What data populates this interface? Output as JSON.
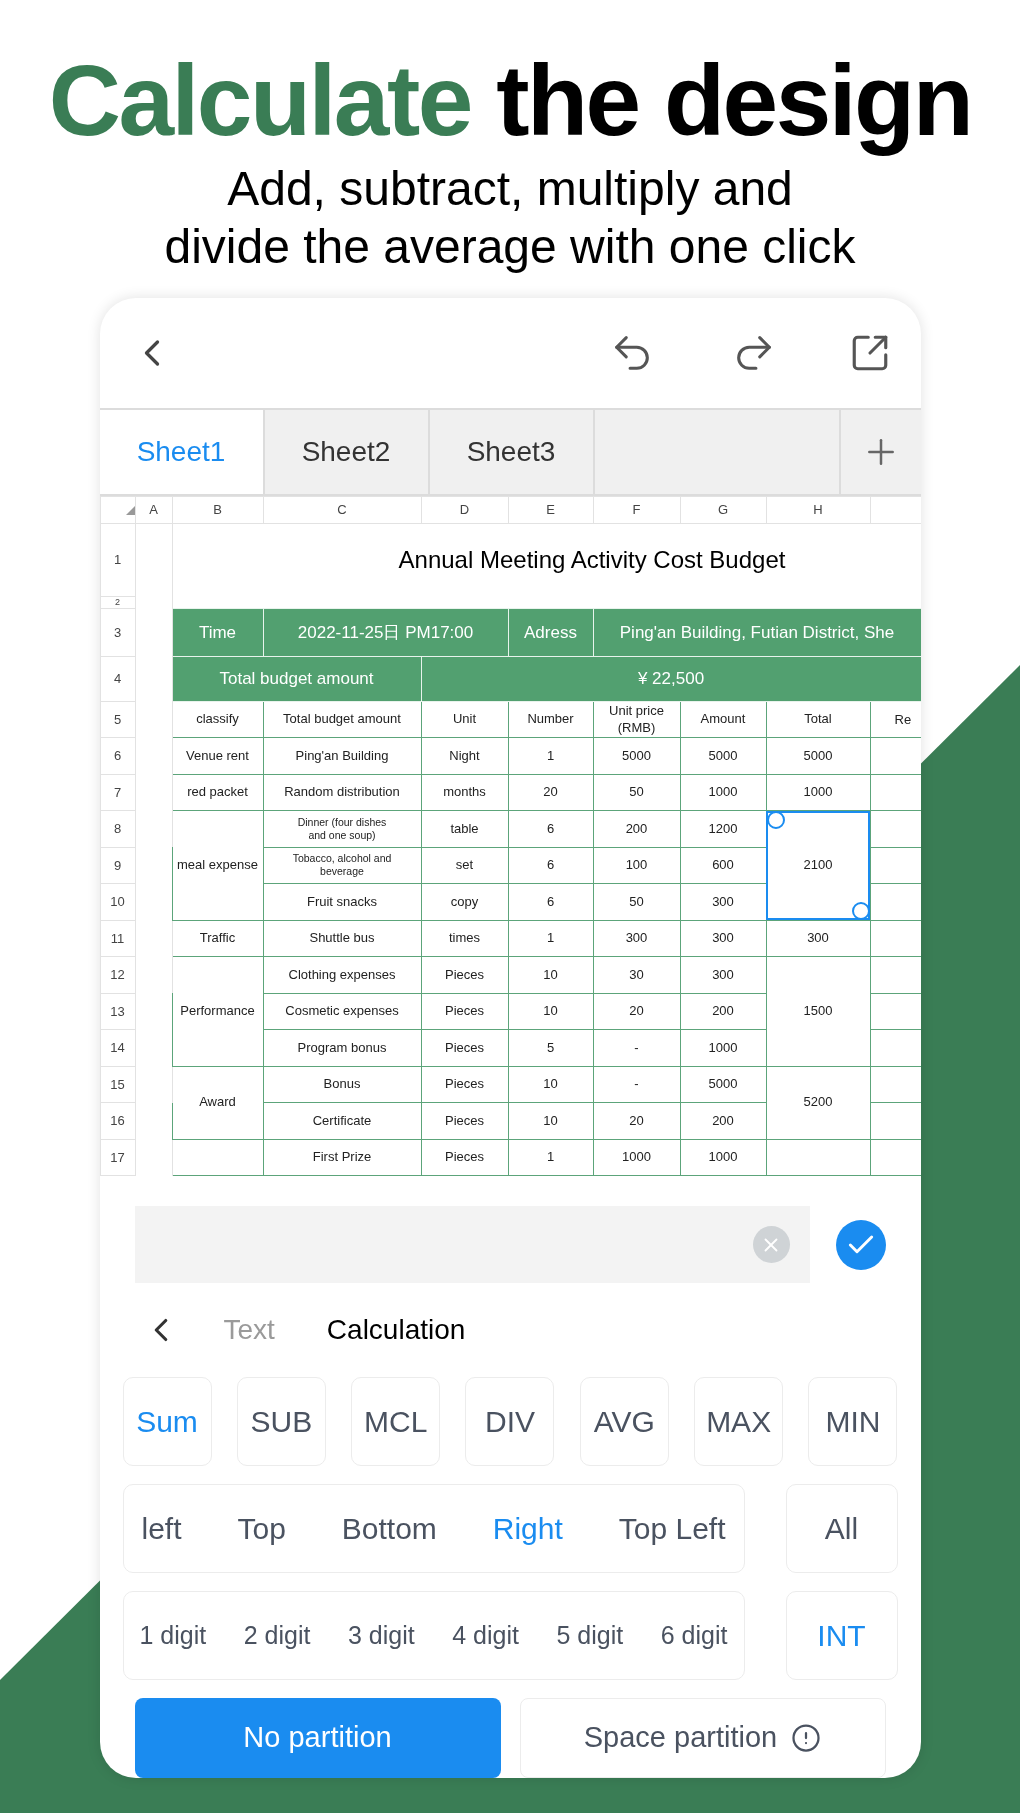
{
  "headline": {
    "parts": [
      {
        "text": "Calculate",
        "kind": "accent"
      },
      {
        "text": "the design",
        "kind": "plain"
      }
    ]
  },
  "subtitle": [
    "Add, subtract, multiply and",
    "divide the average with one click"
  ],
  "tabs": [
    {
      "label": "Sheet1",
      "selected": true
    },
    {
      "label": "Sheet2",
      "selected": false
    },
    {
      "label": "Sheet3",
      "selected": false
    }
  ],
  "sheet": {
    "columns": [
      "A",
      "B",
      "C",
      "D",
      "E",
      "F",
      "G",
      "H"
    ],
    "rows": [
      {
        "number": "1",
        "cells": [
          {
            "kind": "blank",
            "selected": false
          },
          {
            "kind": "title",
            "text": "Annual Meeting Activity Cost Budget",
            "colspan": 7,
            "selected": false
          }
        ]
      },
      {
        "number": "2"
      },
      {
        "number": "3",
        "cells": [
          {
            "kind": "band",
            "text": "Time",
            "selected": false
          },
          {
            "kind": "band",
            "text": "2022-11-25日 PM17:00",
            "colspan": 2,
            "selected": false
          },
          {
            "kind": "band",
            "text": "Adress",
            "selected": false
          },
          {
            "kind": "band",
            "text": "Ping'an Building, Futian District, She",
            "colspan": 4,
            "selected": false
          }
        ]
      },
      {
        "number": "4",
        "cells": [
          {
            "kind": "band",
            "text": "Total budget amount",
            "colspan": 2,
            "selected": false
          },
          {
            "kind": "band",
            "text": "¥ 22,500",
            "colspan": 6,
            "selected": false
          }
        ]
      },
      {
        "number": "5",
        "cells": [
          {
            "kind": "head",
            "text": "classify",
            "selected": false
          },
          {
            "kind": "head",
            "text": "Total budget amount",
            "selected": false
          },
          {
            "kind": "head",
            "text": "Unit",
            "selected": false
          },
          {
            "kind": "head",
            "text": "Number",
            "selected": false
          },
          {
            "kind": "head",
            "text": "Unit price (RMB)",
            "selected": false
          },
          {
            "kind": "head",
            "text": "Amount",
            "selected": false
          },
          {
            "kind": "head",
            "text": "Total",
            "selected": false
          },
          {
            "kind": "edge",
            "text": "Re",
            "selected": false
          }
        ]
      },
      {
        "number": "6",
        "cells": [
          {
            "kind": "data",
            "text": "Venue rent",
            "selected": false
          },
          {
            "kind": "data",
            "text": "Ping'an Building",
            "selected": false
          },
          {
            "kind": "data",
            "text": "Night",
            "selected": false
          },
          {
            "kind": "data",
            "text": "1",
            "selected": false
          },
          {
            "kind": "data",
            "text": "5000",
            "selected": false
          },
          {
            "kind": "data",
            "text": "5000",
            "selected": false
          },
          {
            "kind": "data",
            "text": "5000",
            "selected": false
          },
          {
            "kind": "empty",
            "selected": false
          }
        ]
      },
      {
        "number": "7",
        "cells": [
          {
            "kind": "data",
            "text": "red packet",
            "selected": false
          },
          {
            "kind": "data",
            "text": "Random distribution",
            "selected": false
          },
          {
            "kind": "data",
            "text": "months",
            "selected": false
          },
          {
            "kind": "data",
            "text": "20",
            "selected": false
          },
          {
            "kind": "data",
            "text": "50",
            "selected": false
          },
          {
            "kind": "data",
            "text": "1000",
            "selected": false
          },
          {
            "kind": "data",
            "text": "1000",
            "selected": false
          },
          {
            "kind": "empty",
            "selected": false
          }
        ]
      },
      {
        "number": "8",
        "cells": [
          {
            "kind": "data",
            "text": "meal expense",
            "rowspan": 3,
            "selected": false
          },
          {
            "kind": "small",
            "text": "Dinner (four dishes and one soup)",
            "selected": false
          },
          {
            "kind": "data",
            "text": "table",
            "selected": false
          },
          {
            "kind": "data",
            "text": "6",
            "selected": false
          },
          {
            "kind": "data",
            "text": "200",
            "selected": false
          },
          {
            "kind": "data",
            "text": "1200",
            "selected": false
          },
          {
            "kind": "data",
            "text": "2100",
            "rowspan": 3,
            "selected": true
          },
          {
            "kind": "empty",
            "selected": false
          }
        ]
      },
      {
        "number": "9",
        "cells": [
          {
            "kind": "small",
            "text": "Tobacco, alcohol and beverage",
            "selected": false
          },
          {
            "kind": "data",
            "text": "set",
            "selected": false
          },
          {
            "kind": "data",
            "text": "6",
            "selected": false
          },
          {
            "kind": "data",
            "text": "100",
            "selected": false
          },
          {
            "kind": "data",
            "text": "600",
            "selected": false
          },
          {
            "kind": "empty",
            "selected": false
          }
        ]
      },
      {
        "number": "10",
        "cells": [
          {
            "kind": "data",
            "text": "Fruit snacks",
            "selected": false
          },
          {
            "kind": "data",
            "text": "copy",
            "selected": false
          },
          {
            "kind": "data",
            "text": "6",
            "selected": false
          },
          {
            "kind": "data",
            "text": "50",
            "selected": false
          },
          {
            "kind": "data",
            "text": "300",
            "selected": false
          },
          {
            "kind": "empty",
            "selected": false
          }
        ]
      },
      {
        "number": "11",
        "cells": [
          {
            "kind": "data",
            "text": "Traffic",
            "selected": false
          },
          {
            "kind": "data",
            "text": "Shuttle bus",
            "selected": false
          },
          {
            "kind": "data",
            "text": "times",
            "selected": false
          },
          {
            "kind": "data",
            "text": "1",
            "selected": false
          },
          {
            "kind": "data",
            "text": "300",
            "selected": false
          },
          {
            "kind": "data",
            "text": "300",
            "selected": false
          },
          {
            "kind": "data",
            "text": "300",
            "selected": false
          },
          {
            "kind": "empty",
            "selected": false
          }
        ]
      },
      {
        "number": "12",
        "cells": [
          {
            "kind": "data",
            "text": "Performance",
            "rowspan": 3,
            "selected": false
          },
          {
            "kind": "data",
            "text": "Clothing expenses",
            "selected": false
          },
          {
            "kind": "data",
            "text": "Pieces",
            "selected": false
          },
          {
            "kind": "data",
            "text": "10",
            "selected": false
          },
          {
            "kind": "data",
            "text": "30",
            "selected": false
          },
          {
            "kind": "data",
            "text": "300",
            "selected": false
          },
          {
            "kind": "data",
            "text": "1500",
            "rowspan": 3,
            "selected": false
          },
          {
            "kind": "empty",
            "selected": false
          }
        ]
      },
      {
        "number": "13",
        "cells": [
          {
            "kind": "data",
            "text": "Cosmetic expenses",
            "selected": false
          },
          {
            "kind": "data",
            "text": "Pieces",
            "selected": false
          },
          {
            "kind": "data",
            "text": "10",
            "selected": false
          },
          {
            "kind": "data",
            "text": "20",
            "selected": false
          },
          {
            "kind": "data",
            "text": "200",
            "selected": false
          },
          {
            "kind": "empty",
            "selected": false
          }
        ]
      },
      {
        "number": "14",
        "cells": [
          {
            "kind": "data",
            "text": "Program bonus",
            "selected": false
          },
          {
            "kind": "data",
            "text": "Pieces",
            "selected": false
          },
          {
            "kind": "data",
            "text": "5",
            "selected": false
          },
          {
            "kind": "data",
            "text": "-",
            "selected": false
          },
          {
            "kind": "data",
            "text": "1000",
            "selected": false
          },
          {
            "kind": "empty",
            "selected": false
          }
        ]
      },
      {
        "number": "15",
        "cells": [
          {
            "kind": "data",
            "text": "Award",
            "rowspan": 2,
            "selected": false
          },
          {
            "kind": "data",
            "text": "Bonus",
            "selected": false
          },
          {
            "kind": "data",
            "text": "Pieces",
            "selected": false
          },
          {
            "kind": "data",
            "text": "10",
            "selected": false
          },
          {
            "kind": "data",
            "text": "-",
            "selected": false
          },
          {
            "kind": "data",
            "text": "5000",
            "selected": false
          },
          {
            "kind": "data",
            "text": "5200",
            "rowspan": 2,
            "selected": false
          },
          {
            "kind": "empty",
            "selected": false
          }
        ]
      },
      {
        "number": "16",
        "cells": [
          {
            "kind": "data",
            "text": "Certificate",
            "selected": false
          },
          {
            "kind": "data",
            "text": "Pieces",
            "selected": false
          },
          {
            "kind": "data",
            "text": "10",
            "selected": false
          },
          {
            "kind": "data",
            "text": "20",
            "selected": false
          },
          {
            "kind": "data",
            "text": "200",
            "selected": false
          },
          {
            "kind": "empty",
            "selected": false
          }
        ]
      },
      {
        "number": "17",
        "cells": [
          {
            "kind": "empty",
            "selected": false
          },
          {
            "kind": "data",
            "text": "First Prize",
            "selected": false
          },
          {
            "kind": "data",
            "text": "Pieces",
            "selected": false
          },
          {
            "kind": "data",
            "text": "1",
            "selected": false
          },
          {
            "kind": "data",
            "text": "1000",
            "selected": false
          },
          {
            "kind": "data",
            "text": "1000",
            "selected": false
          },
          {
            "kind": "empty",
            "selected": false
          },
          {
            "kind": "empty",
            "selected": false
          }
        ]
      }
    ]
  },
  "mode_tabs": [
    {
      "label": "Text",
      "selected": false
    },
    {
      "label": "Calculation",
      "selected": true
    }
  ],
  "functions": [
    {
      "label": "Sum",
      "selected": true
    },
    {
      "label": "SUB",
      "selected": false
    },
    {
      "label": "MCL",
      "selected": false
    },
    {
      "label": "DIV",
      "selected": false
    },
    {
      "label": "AVG",
      "selected": false
    },
    {
      "label": "MAX",
      "selected": false
    },
    {
      "label": "MIN",
      "selected": false
    }
  ],
  "directions": [
    {
      "label": "left",
      "selected": false
    },
    {
      "label": "Top",
      "selected": false
    },
    {
      "label": "Bottom",
      "selected": false
    },
    {
      "label": "Right",
      "selected": true
    },
    {
      "label": "Top Left",
      "selected": false
    }
  ],
  "all_button": {
    "label": "All",
    "selected": false
  },
  "digits": [
    {
      "label": "1 digit",
      "selected": false
    },
    {
      "label": "2 digit",
      "selected": false
    },
    {
      "label": "3 digit",
      "selected": false
    },
    {
      "label": "4 digit",
      "selected": false
    },
    {
      "label": "5 digit",
      "selected": false
    },
    {
      "label": "6 digit",
      "selected": false
    }
  ],
  "int_button": {
    "label": "INT",
    "selected": true
  },
  "partitions": [
    {
      "label": "No partition",
      "selected": true,
      "info": false
    },
    {
      "label": "Space partition",
      "selected": false,
      "info": true
    }
  ]
}
